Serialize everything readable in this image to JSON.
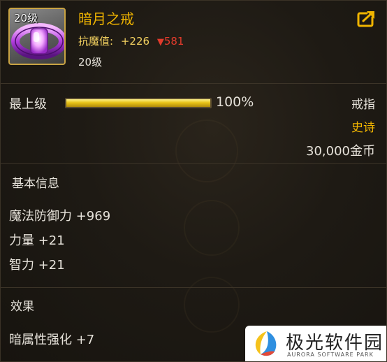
{
  "item": {
    "icon_level": "20级",
    "name": "暗月之戒",
    "resist_label": "抗魔值:",
    "resist_up": "+226",
    "resist_down": "581",
    "level": "20级"
  },
  "icons": {
    "item": "purple-ring-icon",
    "share": "share-arrow-icon",
    "resist_down": "red-down-triangle-icon"
  },
  "enhance": {
    "label": "最上级",
    "percent_text": "100%",
    "progress": 1.0
  },
  "meta": {
    "type": "戒指",
    "rarity": "史诗",
    "price": "30,000金币"
  },
  "basic_info": {
    "title": "基本信息",
    "stats": [
      "魔法防御力 +969",
      "力量 +21",
      "智力 +21"
    ]
  },
  "effects": {
    "title": "效果",
    "stats": [
      "暗属性强化 +7"
    ]
  },
  "watermark": {
    "cn": "极光软件园",
    "en": "AURORA SOFTWARE PARK"
  },
  "colors": {
    "name": "#f0b400",
    "resist_label": "#f3d160",
    "resist_down": "#e33b2c",
    "rarity": "#f0b400",
    "bar": "#e8c317"
  }
}
